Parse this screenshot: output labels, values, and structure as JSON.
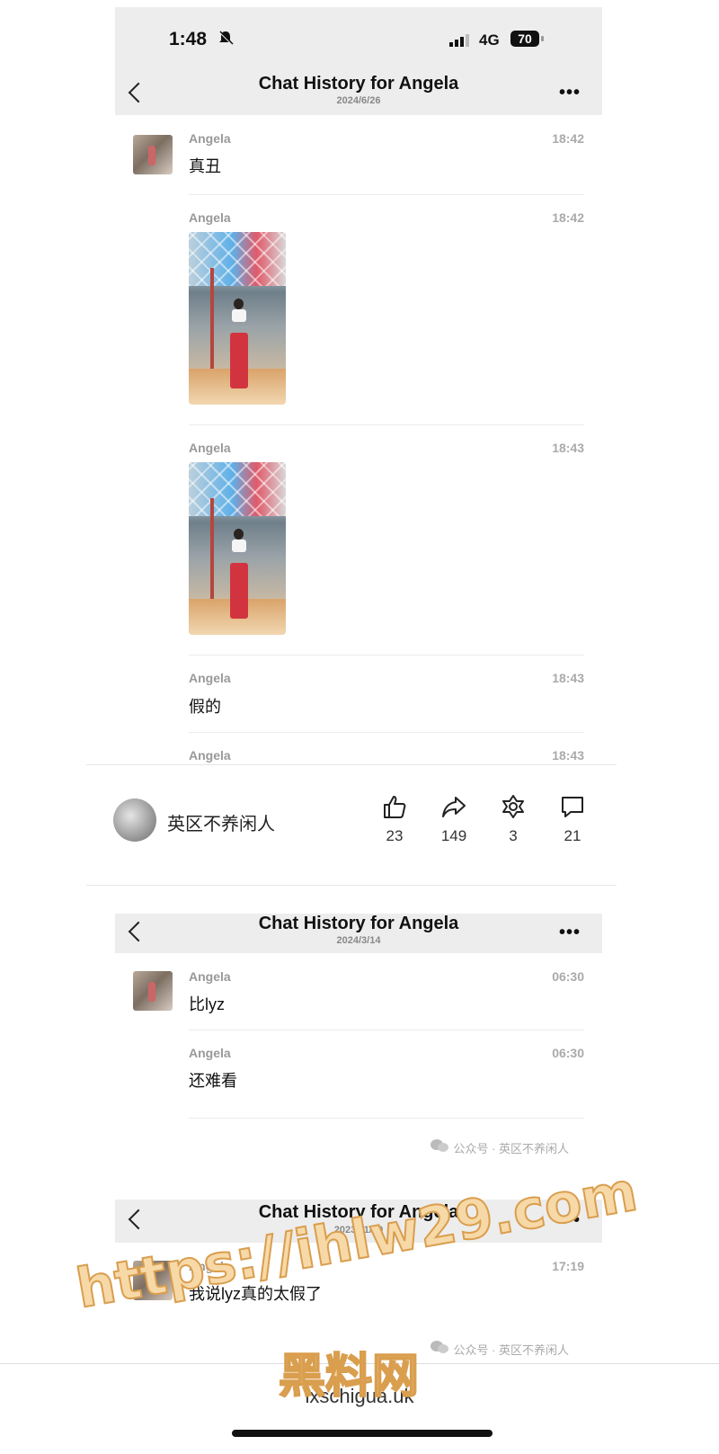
{
  "status_bar": {
    "time": "1:48",
    "network": "4G",
    "battery": "70"
  },
  "panels": [
    {
      "title": "Chat History for Angela",
      "date": "2024/6/26",
      "messages": [
        {
          "sender": "Angela",
          "time": "18:42",
          "text": "真丑"
        },
        {
          "sender": "Angela",
          "time": "18:42",
          "text": ""
        },
        {
          "sender": "Angela",
          "time": "18:43",
          "text": ""
        },
        {
          "sender": "Angela",
          "time": "18:43",
          "text": "假的"
        },
        {
          "sender": "Angela",
          "time": "18:43",
          "text": ""
        }
      ]
    },
    {
      "title": "Chat History for Angela",
      "date": "2024/3/14",
      "messages": [
        {
          "sender": "Angela",
          "time": "06:30",
          "text": "比lyz"
        },
        {
          "sender": "Angela",
          "time": "06:30",
          "text": "还难看"
        }
      ]
    },
    {
      "title": "Chat History for Angela",
      "date": "2023/11/19",
      "messages": [
        {
          "sender": "Angela",
          "time": "17:19",
          "text": "我说lyz真的太假了"
        }
      ]
    }
  ],
  "social_bar": {
    "account_name": "英区不养闲人",
    "likes": "23",
    "shares": "149",
    "favorites": "3",
    "comments": "21"
  },
  "source_watermark": "公众号 · 英区不养闲人",
  "overlay_watermark": {
    "url": "https://ihlw29.com",
    "label": "黑料网"
  },
  "footer_url": "lxschigua.uk"
}
